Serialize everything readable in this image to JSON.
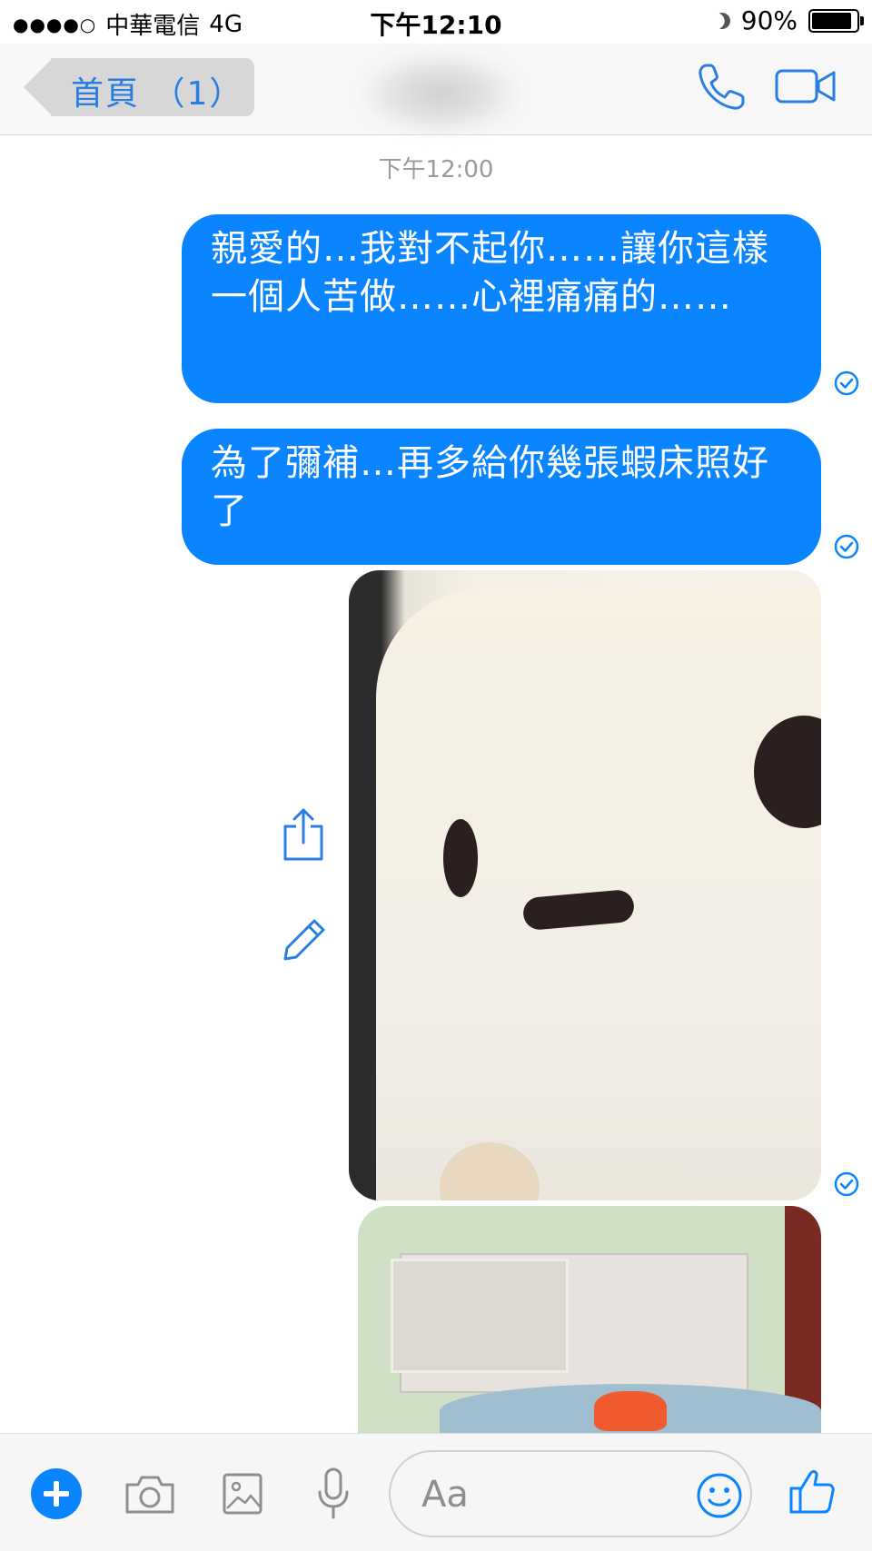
{
  "status_bar": {
    "signal": "●●●●○",
    "carrier": "中華電信",
    "network": "4G",
    "time": "下午12:10",
    "battery": "90%",
    "battery_level": 0.9
  },
  "nav": {
    "back_label": "首頁 （1）",
    "phone_icon": "phone-icon",
    "video_icon": "video-call-icon"
  },
  "thread": {
    "timestamp": "下午12:00",
    "messages": [
      {
        "type": "text",
        "text": "親愛的…我對不起你……讓你這樣一個人苦做……心裡痛痛的……",
        "status": "sent-check"
      },
      {
        "type": "text",
        "text": "為了彌補…再多給你幾張蝦床照好了",
        "status": "sent-check"
      },
      {
        "type": "photo",
        "subject": "plush-toy-face",
        "status": "sent-check"
      },
      {
        "type": "photo",
        "subject": "bed-headboard-shelf"
      }
    ],
    "photo_actions": [
      "share-icon",
      "edit-icon"
    ]
  },
  "composer": {
    "placeholder": "Aa",
    "buttons": [
      "plus",
      "camera",
      "gallery",
      "microphone",
      "emoji",
      "like"
    ],
    "accent_color": "#0a84ff"
  },
  "colors": {
    "bubble": "#0a84ff",
    "nav_link": "#2a7de1",
    "timestamp": "#9b9b9b"
  }
}
